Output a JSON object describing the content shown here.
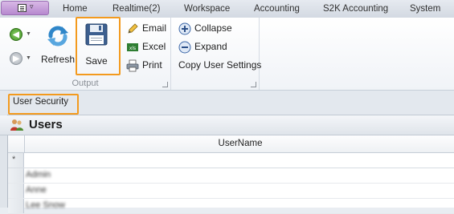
{
  "tabs": [
    "Home",
    "Realtime(2)",
    "Workspace",
    "Accounting",
    "S2K Accounting",
    "System"
  ],
  "ribbon": {
    "refresh_label": "Refresh",
    "save_label": "Save",
    "email_label": "Email",
    "excel_label": "Excel",
    "print_label": "Print",
    "output_group": "Output",
    "collapse_label": "Collapse",
    "expand_label": "Expand",
    "copy_settings_label": "Copy User Settings"
  },
  "document_tab": "User Security",
  "panel_title": "Users",
  "grid": {
    "column": "UserName",
    "new_row_marker": "*",
    "rows": [
      "Admin",
      "Anne",
      "Lee Snow"
    ]
  },
  "colors": {
    "highlight": "#f39a1e",
    "app_button": "#b788cf"
  }
}
